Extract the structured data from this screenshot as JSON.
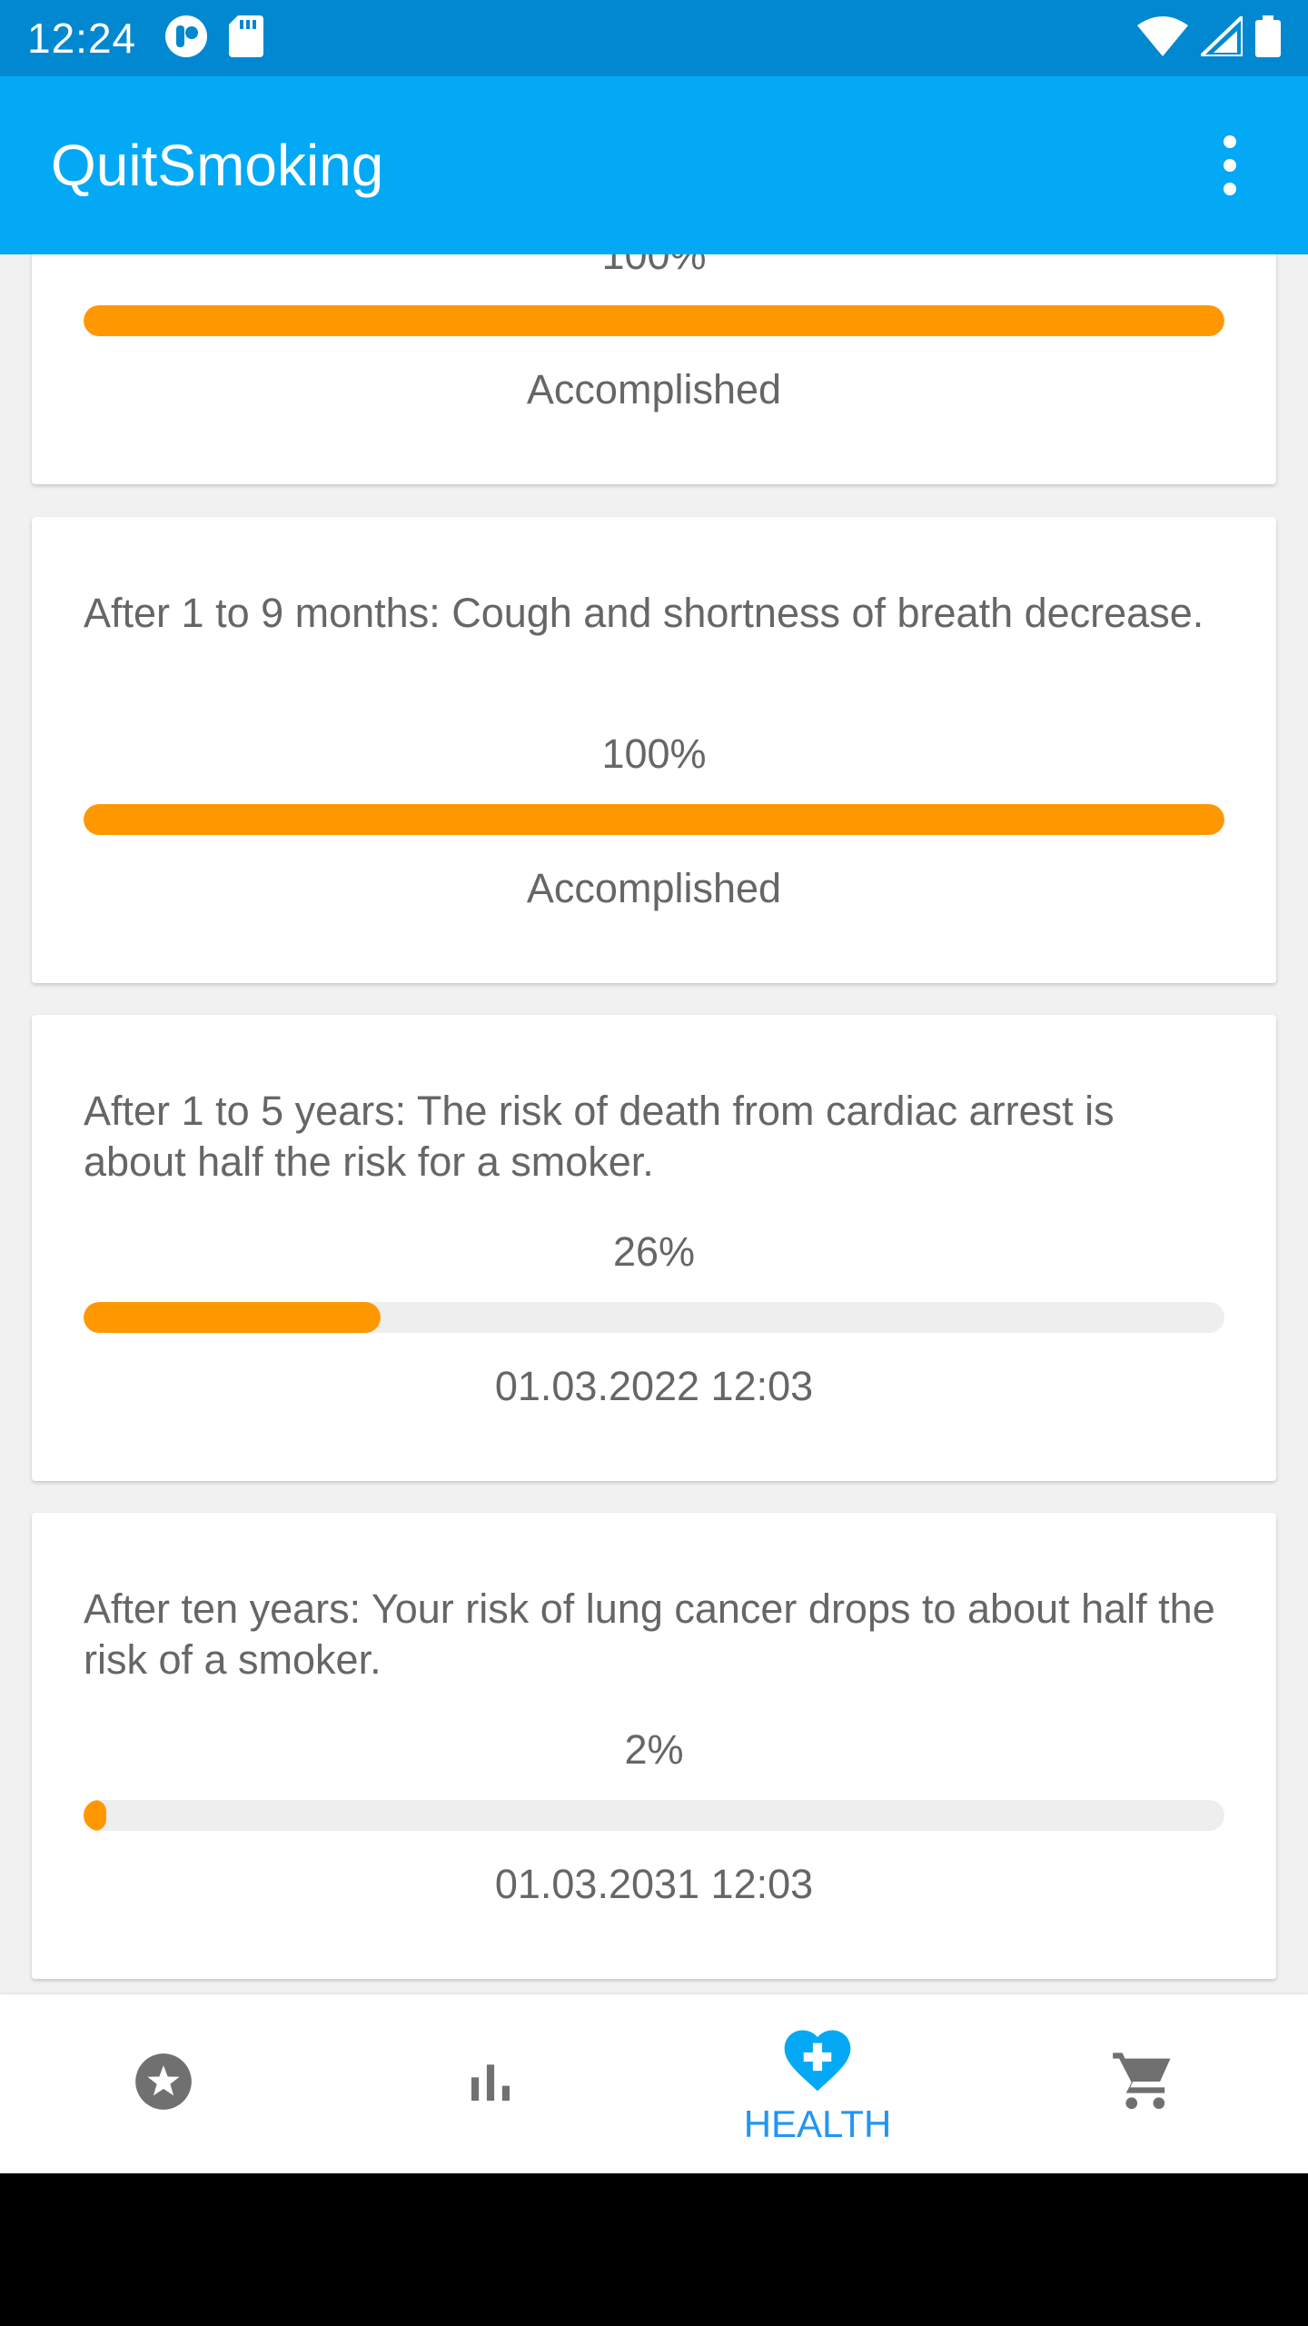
{
  "status_bar": {
    "time": "12:24"
  },
  "app_bar": {
    "title": "QuitSmoking"
  },
  "colors": {
    "primary": "#03a9f4",
    "primary_dark": "#0288d1",
    "progress": "#ff9800",
    "active_nav": "#2196f3"
  },
  "cards": [
    {
      "description": "",
      "percent": "100%",
      "progress": 1.0,
      "status": "Accomplished"
    },
    {
      "description": "After 1 to 9 months: Cough and shortness of breath decrease.",
      "percent": "100%",
      "progress": 1.0,
      "status": "Accomplished"
    },
    {
      "description": "After 1 to 5 years: The risk of death from cardiac arrest is about half the risk for a smoker.",
      "percent": "26%",
      "progress": 0.26,
      "status": "01.03.2022 12:03"
    },
    {
      "description": "After ten years: Your risk of lung cancer drops to about half the risk of a smoker.",
      "percent": "2%",
      "progress": 0.02,
      "status": "01.03.2031 12:03"
    }
  ],
  "bottom_nav": {
    "items": [
      {
        "icon": "star-circle-icon",
        "label": ""
      },
      {
        "icon": "bar-chart-icon",
        "label": ""
      },
      {
        "icon": "heart-plus-icon",
        "label": "HEALTH"
      },
      {
        "icon": "shopping-cart-icon",
        "label": ""
      }
    ]
  }
}
